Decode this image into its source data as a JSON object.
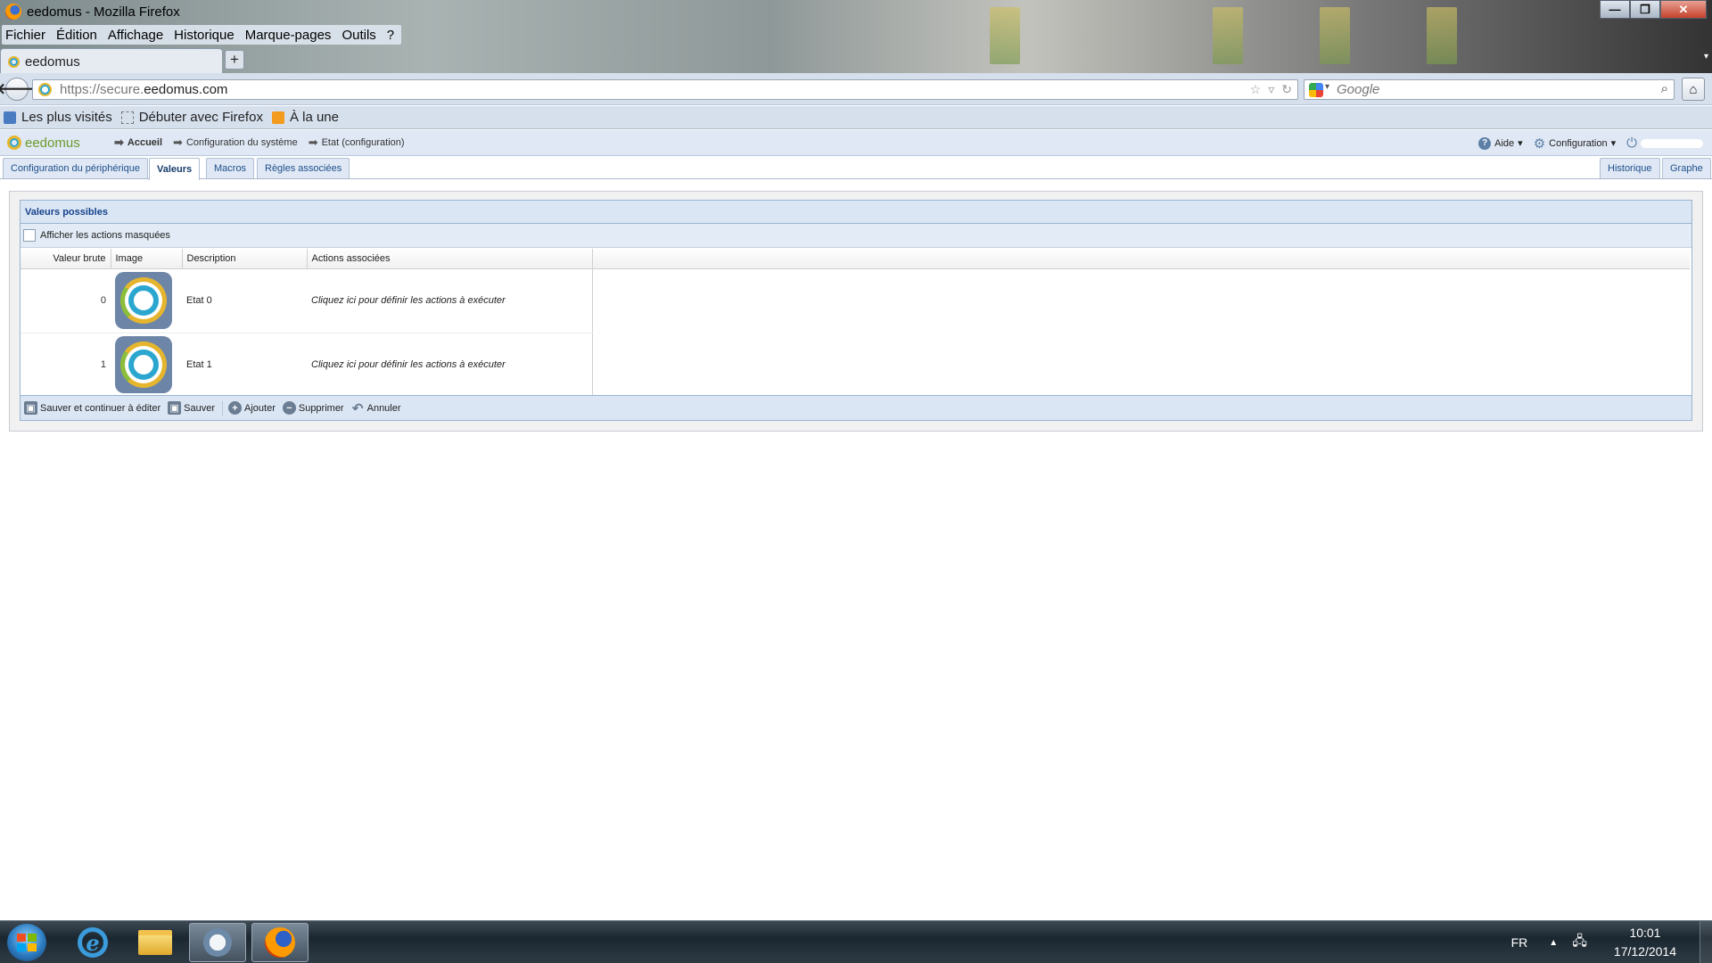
{
  "window": {
    "title": "eedomus - Mozilla Firefox",
    "controls": {
      "minimize": "—",
      "maximize": "❐",
      "close": "✕"
    }
  },
  "menu": [
    "Fichier",
    "Édition",
    "Affichage",
    "Historique",
    "Marque-pages",
    "Outils",
    "?"
  ],
  "browser_tab": {
    "label": "eedomus",
    "new_tab": "+",
    "scroll": "▾"
  },
  "navbar": {
    "back": "🡐",
    "url_prefix": "https://secure.",
    "url_domain": "eedomus.com",
    "search_placeholder": "Google",
    "icons": [
      "☆",
      "▿",
      "↻"
    ],
    "search_icon": "⌕",
    "home_icon": "⌂"
  },
  "bookmarks": [
    "Les plus visités",
    "Débuter avec Firefox",
    "À la une"
  ],
  "app_header": {
    "logo": "eedomus",
    "breadcrumbs": [
      "Accueil",
      "Configuration du système",
      "Etat (configuration)"
    ],
    "help": "Aide",
    "config": "Configuration",
    "caret": "▾",
    "breadcrumb_arrow": "➡",
    "help_icon": "?",
    "gear_icon": "⚙",
    "power_icon": "⏻"
  },
  "subtabs": {
    "left": [
      "Configuration du périphérique",
      "Valeurs",
      "Macros",
      "Règles associées"
    ],
    "active": "Valeurs",
    "right": [
      "Historique",
      "Graphe"
    ]
  },
  "panel": {
    "title": "Valeurs possibles",
    "show_hidden_label": "Afficher les actions masquées",
    "columns": [
      "Valeur brute",
      "Image",
      "Description",
      "Actions associées"
    ],
    "rows": [
      {
        "raw": "0",
        "description": "Etat 0",
        "actions": "Cliquez ici pour définir les actions à exécuter"
      },
      {
        "raw": "1",
        "description": "Etat 1",
        "actions": "Cliquez ici pour définir les actions à exécuter"
      }
    ],
    "buttons": {
      "save_continue": "Sauver et continuer à éditer",
      "save": "Sauver",
      "add": "Ajouter",
      "delete": "Supprimer",
      "cancel": "Annuler"
    },
    "button_icons": {
      "save": "▣",
      "add": "+",
      "delete": "−",
      "cancel": "↶"
    }
  },
  "taskbar": {
    "language": "FR",
    "tray_arrow": "▲",
    "network_icon": "🖧",
    "time": "10:01",
    "date": "17/12/2014",
    "ie_letter": "e"
  },
  "colors": {
    "accent_blue": "#15428b",
    "panel_header": "#dbe6f4",
    "logo_green": "#6c9b2c",
    "logo_yellow": "#e5b52d",
    "logo_blue": "#2ba6cf"
  }
}
